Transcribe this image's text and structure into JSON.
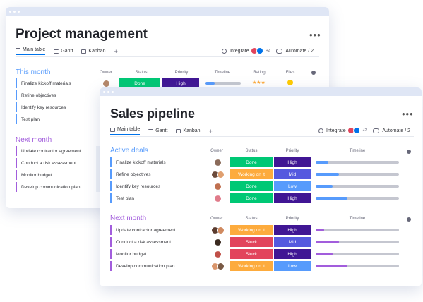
{
  "colors": {
    "blue_group": "#579bfc",
    "purple_group": "#a25ddc",
    "done": "#00c875",
    "working": "#fdab3d",
    "stuck": "#e2445c",
    "high": "#401694",
    "mid": "#5559df",
    "low": "#579bfc",
    "timeline_track": "#c5c7d0"
  },
  "back_window": {
    "title": "Project management",
    "menu": "•••",
    "views": [
      {
        "label": "Main table",
        "icon": "table-icon"
      },
      {
        "label": "Gantt",
        "icon": "gantt-icon"
      },
      {
        "label": "Kanban",
        "icon": "kanban-icon"
      }
    ],
    "add_view": "+",
    "integrate": "Integrate",
    "integrate_more": "+2",
    "automate": "Automate / 2",
    "columns": [
      "Owner",
      "Status",
      "Priority",
      "Timeline",
      "Rating",
      "Files"
    ],
    "first_row_status": "Done",
    "first_row_priority": "High",
    "groups": [
      {
        "title": "This month",
        "tasks": [
          "Finalize kickoff materials",
          "Refine objectives",
          "Identify key resources",
          "Test plan"
        ]
      },
      {
        "title": "Next month",
        "tasks": [
          "Update contractor agreement",
          "Conduct a risk assessment",
          "Monitor budget",
          "Develop communication plan"
        ]
      }
    ]
  },
  "front_window": {
    "title": "Sales pipeline",
    "menu": "•••",
    "views": [
      {
        "label": "Main table",
        "icon": "table-icon"
      },
      {
        "label": "Gantt",
        "icon": "gantt-icon"
      },
      {
        "label": "Kanban",
        "icon": "kanban-icon"
      }
    ],
    "add_view": "+",
    "integrate": "Integrate",
    "integrate_more": "+2",
    "automate": "Automate / 2",
    "groups": [
      {
        "title": "Active deals",
        "columns": [
          "Owner",
          "Status",
          "Priority",
          "Timeline"
        ],
        "rows": [
          {
            "task": "Finalize kickoff materials",
            "status": "Done",
            "status_color": "#00c875",
            "priority": "High",
            "priority_color": "#401694",
            "timeline": 0.15,
            "timeline_color": "#579bfc"
          },
          {
            "task": "Refine objectives",
            "status": "Working on it",
            "status_color": "#fdab3d",
            "priority": "Mid",
            "priority_color": "#5559df",
            "timeline": 0.28,
            "timeline_color": "#579bfc"
          },
          {
            "task": "Identify key resources",
            "status": "Done",
            "status_color": "#00c875",
            "priority": "Low",
            "priority_color": "#579bfc",
            "timeline": 0.2,
            "timeline_color": "#579bfc"
          },
          {
            "task": "Test plan",
            "status": "Done",
            "status_color": "#00c875",
            "priority": "High",
            "priority_color": "#401694",
            "timeline": 0.38,
            "timeline_color": "#579bfc"
          }
        ]
      },
      {
        "title": "Next month",
        "columns": [
          "Owner",
          "Status",
          "Priority",
          "Timeline"
        ],
        "rows": [
          {
            "task": "Update contractor agreement",
            "status": "Working on it",
            "status_color": "#fdab3d",
            "priority": "High",
            "priority_color": "#401694",
            "timeline": 0.1,
            "timeline_color": "#a25ddc"
          },
          {
            "task": "Conduct a risk assessment",
            "status": "Stuck",
            "status_color": "#e2445c",
            "priority": "Mid",
            "priority_color": "#5559df",
            "timeline": 0.28,
            "timeline_color": "#a25ddc"
          },
          {
            "task": "Monitor budget",
            "status": "Stuck",
            "status_color": "#e2445c",
            "priority": "High",
            "priority_color": "#401694",
            "timeline": 0.2,
            "timeline_color": "#a25ddc"
          },
          {
            "task": "Develop communication plan",
            "status": "Working on it",
            "status_color": "#fdab3d",
            "priority": "Low",
            "priority_color": "#579bfc",
            "timeline": 0.38,
            "timeline_color": "#a25ddc"
          }
        ]
      }
    ]
  }
}
